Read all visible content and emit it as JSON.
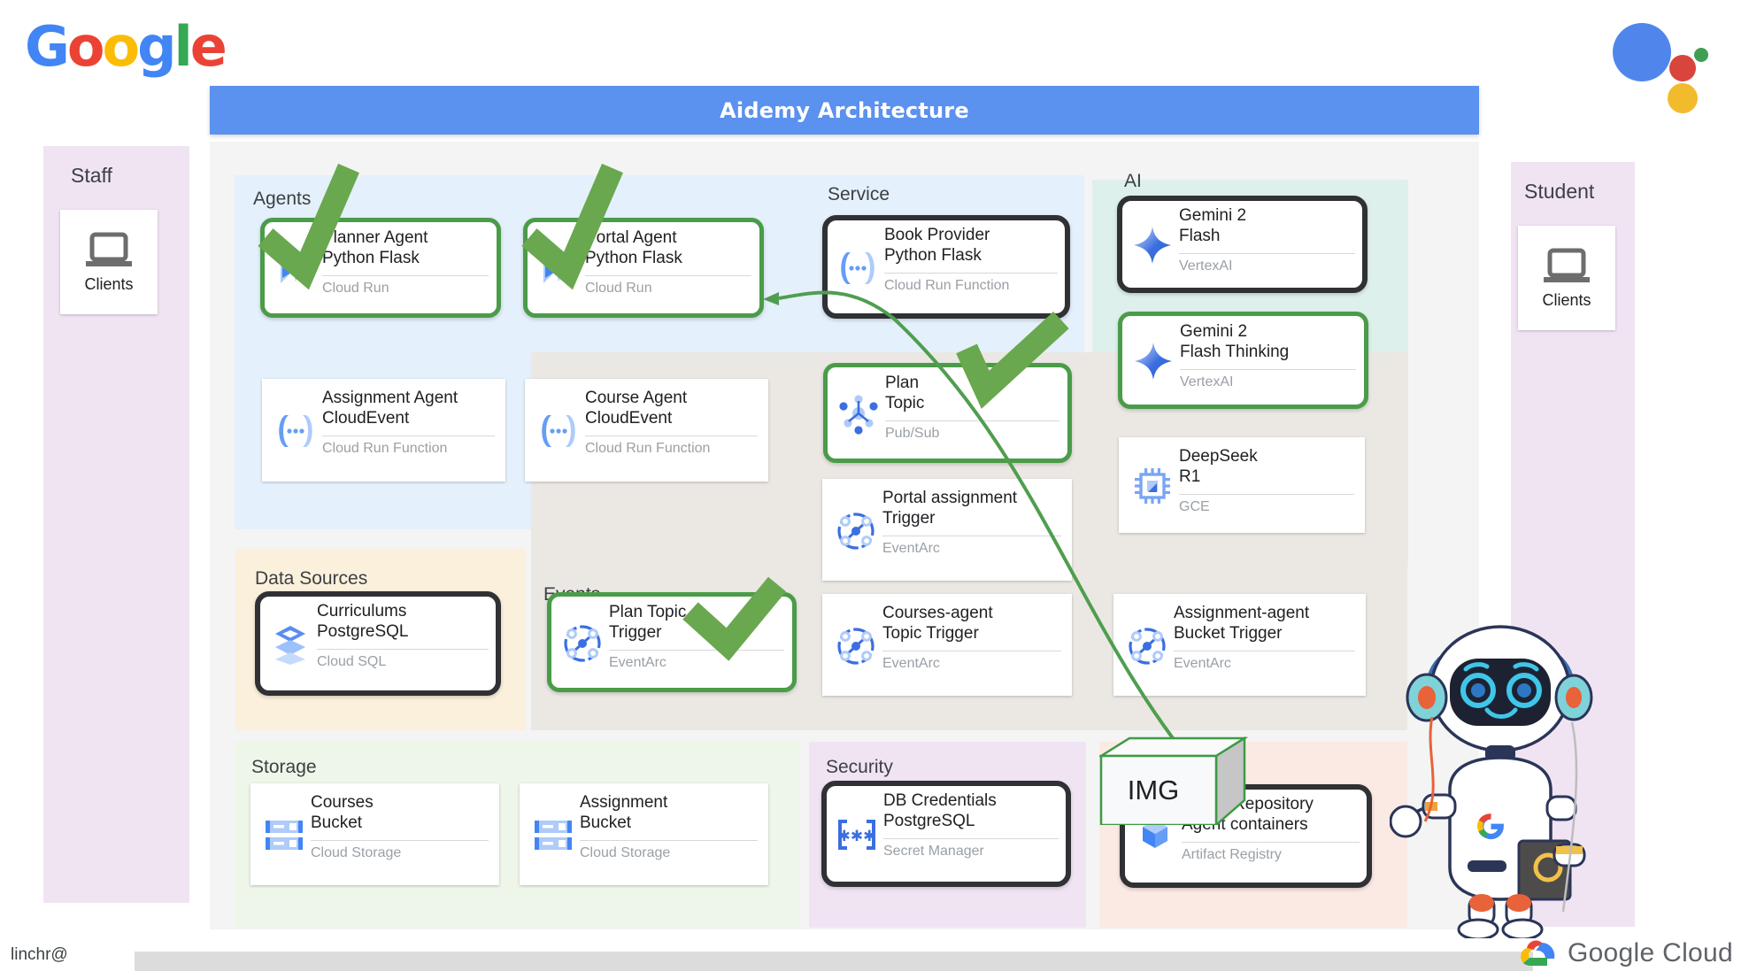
{
  "brand": {
    "google_wordmark": [
      "G",
      "o",
      "o",
      "g",
      "l",
      "e"
    ],
    "google_cloud_label": "Google Cloud",
    "colors": {
      "blue": "#4285F4",
      "red": "#EA4335",
      "yellow": "#FBBC05",
      "green": "#34A853",
      "banner": "#5b91ef",
      "highlight_green": "#4a9c48",
      "highlight_dark": "#2f3134"
    }
  },
  "header": {
    "title": "Aidemy Architecture"
  },
  "footer": {
    "user": "linchr@"
  },
  "actors": [
    {
      "title": "Staff",
      "card_label": "Clients",
      "icon": "laptop-icon"
    },
    {
      "title": "Student",
      "card_label": "Clients",
      "icon": "laptop-icon"
    }
  ],
  "groups": [
    {
      "id": "agents",
      "title": "Agents"
    },
    {
      "id": "service",
      "title": "Service"
    },
    {
      "id": "ai",
      "title": "AI"
    },
    {
      "id": "data_sources",
      "title": "Data Sources"
    },
    {
      "id": "events",
      "title": "Events"
    },
    {
      "id": "storage",
      "title": "Storage"
    },
    {
      "id": "security",
      "title": "Security"
    }
  ],
  "cards": {
    "planner_agent": {
      "line1": "Planner Agent",
      "line2": "Python Flask",
      "sub": "Cloud Run",
      "icon": "cloud-run-icon",
      "highlight": "green"
    },
    "portal_agent": {
      "line1": "Portal Agent",
      "line2": "Python Flask",
      "sub": "Cloud Run",
      "icon": "cloud-run-icon",
      "highlight": "green"
    },
    "assignment_agent": {
      "line1": "Assignment Agent",
      "line2": "CloudEvent",
      "sub": "Cloud Run Function",
      "icon": "cloud-function-icon",
      "highlight": "none"
    },
    "course_agent": {
      "line1": "Course Agent",
      "line2": "CloudEvent",
      "sub": "Cloud Run Function",
      "icon": "cloud-function-icon",
      "highlight": "none"
    },
    "book_provider": {
      "line1": "Book Provider",
      "line2": "Python Flask",
      "sub": "Cloud Run Function",
      "icon": "cloud-function-icon",
      "highlight": "dark"
    },
    "gemini_flash": {
      "line1": "Gemini 2",
      "line2": "Flash",
      "sub": "VertexAI",
      "icon": "gemini-sparkle-icon",
      "highlight": "dark"
    },
    "gemini_thinking": {
      "line1": "Gemini 2",
      "line2": "Flash Thinking",
      "sub": "VertexAI",
      "icon": "gemini-sparkle-icon",
      "highlight": "green"
    },
    "deepseek_r1": {
      "line1": "DeepSeek",
      "line2": "R1",
      "sub": "GCE",
      "icon": "cpu-chip-icon",
      "highlight": "none"
    },
    "plan_topic": {
      "line1": "Plan",
      "line2": "Topic",
      "sub": "Pub/Sub",
      "icon": "pubsub-icon",
      "highlight": "green"
    },
    "portal_assign_trigger": {
      "line1": "Portal assignment",
      "line2": "Trigger",
      "sub": "EventArc",
      "icon": "eventarc-icon",
      "highlight": "none"
    },
    "courses_agent_trigger": {
      "line1": "Courses-agent",
      "line2": "Topic Trigger",
      "sub": "EventArc",
      "icon": "eventarc-icon",
      "highlight": "none"
    },
    "assignment_agent_trigger": {
      "line1": "Assignment-agent",
      "line2": "Bucket Trigger",
      "sub": "EventArc",
      "icon": "eventarc-icon",
      "highlight": "none"
    },
    "plan_topic_trigger": {
      "line1": "Plan Topic",
      "line2": "Trigger",
      "sub": "EventArc",
      "icon": "eventarc-icon",
      "highlight": "green"
    },
    "curriculums": {
      "line1": "Curriculums",
      "line2": "PostgreSQL",
      "sub": "Cloud SQL",
      "icon": "cloud-sql-icon",
      "highlight": "dark"
    },
    "courses_bucket": {
      "line1": "Courses",
      "line2": "Bucket",
      "sub": "Cloud Storage",
      "icon": "cloud-storage-icon",
      "highlight": "none"
    },
    "assignment_bucket": {
      "line1": "Assignment",
      "line2": "Bucket",
      "sub": "Cloud Storage",
      "icon": "cloud-storage-icon",
      "highlight": "none"
    },
    "db_credentials": {
      "line1": "DB Credentials",
      "line2": "PostgreSQL",
      "sub": "Secret Manager",
      "icon": "secret-manager-icon",
      "highlight": "dark"
    },
    "image_repository": {
      "line1": "Image Repository",
      "line2": "Agent containers",
      "sub": "Artifact Registry",
      "icon": "artifact-registry-icon",
      "highlight": "dark"
    }
  },
  "overlays": {
    "img_cube_label": "IMG"
  }
}
